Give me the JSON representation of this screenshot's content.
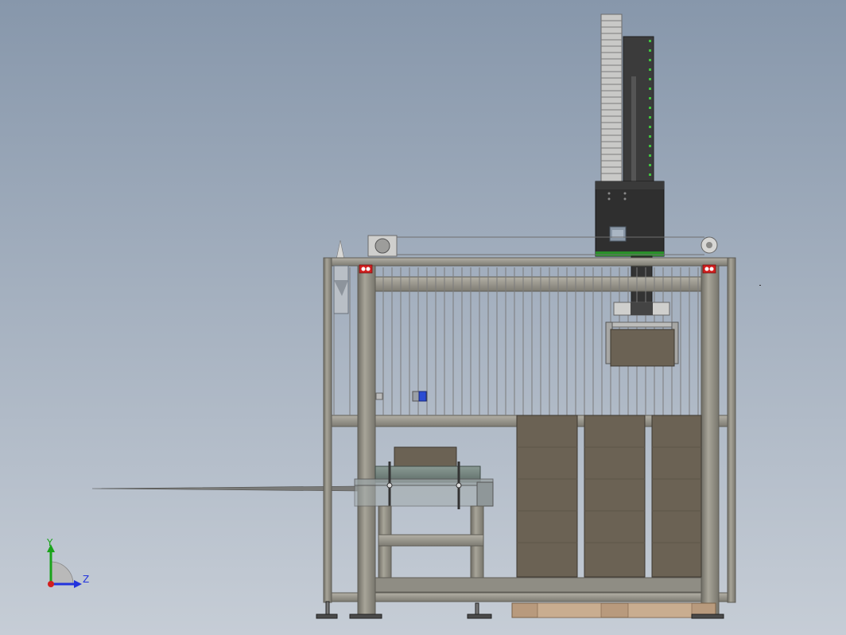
{
  "view": {
    "background_top": "#8797ab",
    "background_bottom": "#c6cdd6"
  },
  "colors": {
    "frame_steel": "#9a978c",
    "frame_edge": "#5f5d56",
    "box_brown": "#6b6254",
    "pallet_wood": "#b89a7d",
    "dark_steel": "#3f3f3f",
    "accent_green": "#41c23f",
    "accent_red": "#d21f1f",
    "accent_blue": "#2a4bd3"
  },
  "triad": {
    "y_label": "Y",
    "z_label": "Z",
    "y_color": "#1aa31a",
    "z_color": "#2233dd",
    "origin_color": "#d21f1f"
  }
}
